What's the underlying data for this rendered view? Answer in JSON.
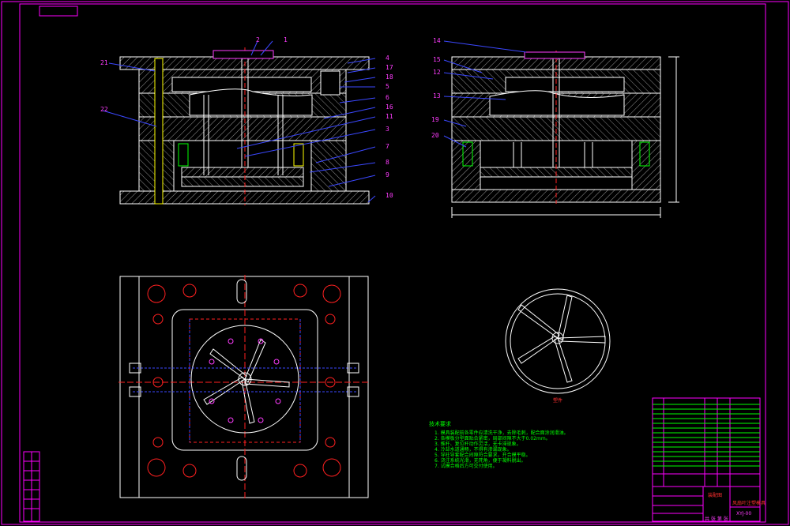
{
  "drawing": {
    "callouts_main": [
      "1",
      "2",
      "21",
      "22",
      "4",
      "17",
      "18",
      "5",
      "6",
      "16",
      "11",
      "3",
      "7",
      "8",
      "9",
      "10"
    ],
    "callouts_side": [
      "14",
      "15",
      "12",
      "13",
      "19",
      "20"
    ],
    "tech_notes": {
      "title": "技术要求",
      "lines": [
        "1. 模具装配前各零件应清洗干净，去除毛刺，配合面涂润滑油。",
        "2. 各模板分型面贴合紧密，局部间隙不大于0.02mm。",
        "3. 推杆、复位杆动作灵活，无卡滞现象。",
        "4. 冷却水道通畅，不得有渗漏现象。",
        "5. 导柱导套配合间隙符合要求，开合模平稳。",
        "6. 浇注系统光滑，无死角，便于凝料脱出。",
        "7. 试模合格后方可交付使用。"
      ]
    },
    "part_view_label": "塑件",
    "title_block": {
      "drawing_title": "风扇叶注塑模具",
      "drawing_number": "XYJ-00",
      "unit": "装配图",
      "footer": "共 张 第 张"
    }
  },
  "colors": {
    "background": "#000000",
    "border": "#ff00ff",
    "lines": "#ffffff",
    "hatch": "#9a9a9a",
    "leader": "#3b48ff",
    "accent_red": "#ff2020",
    "accent_green": "#00ff00",
    "accent_yellow": "#ffff00"
  }
}
